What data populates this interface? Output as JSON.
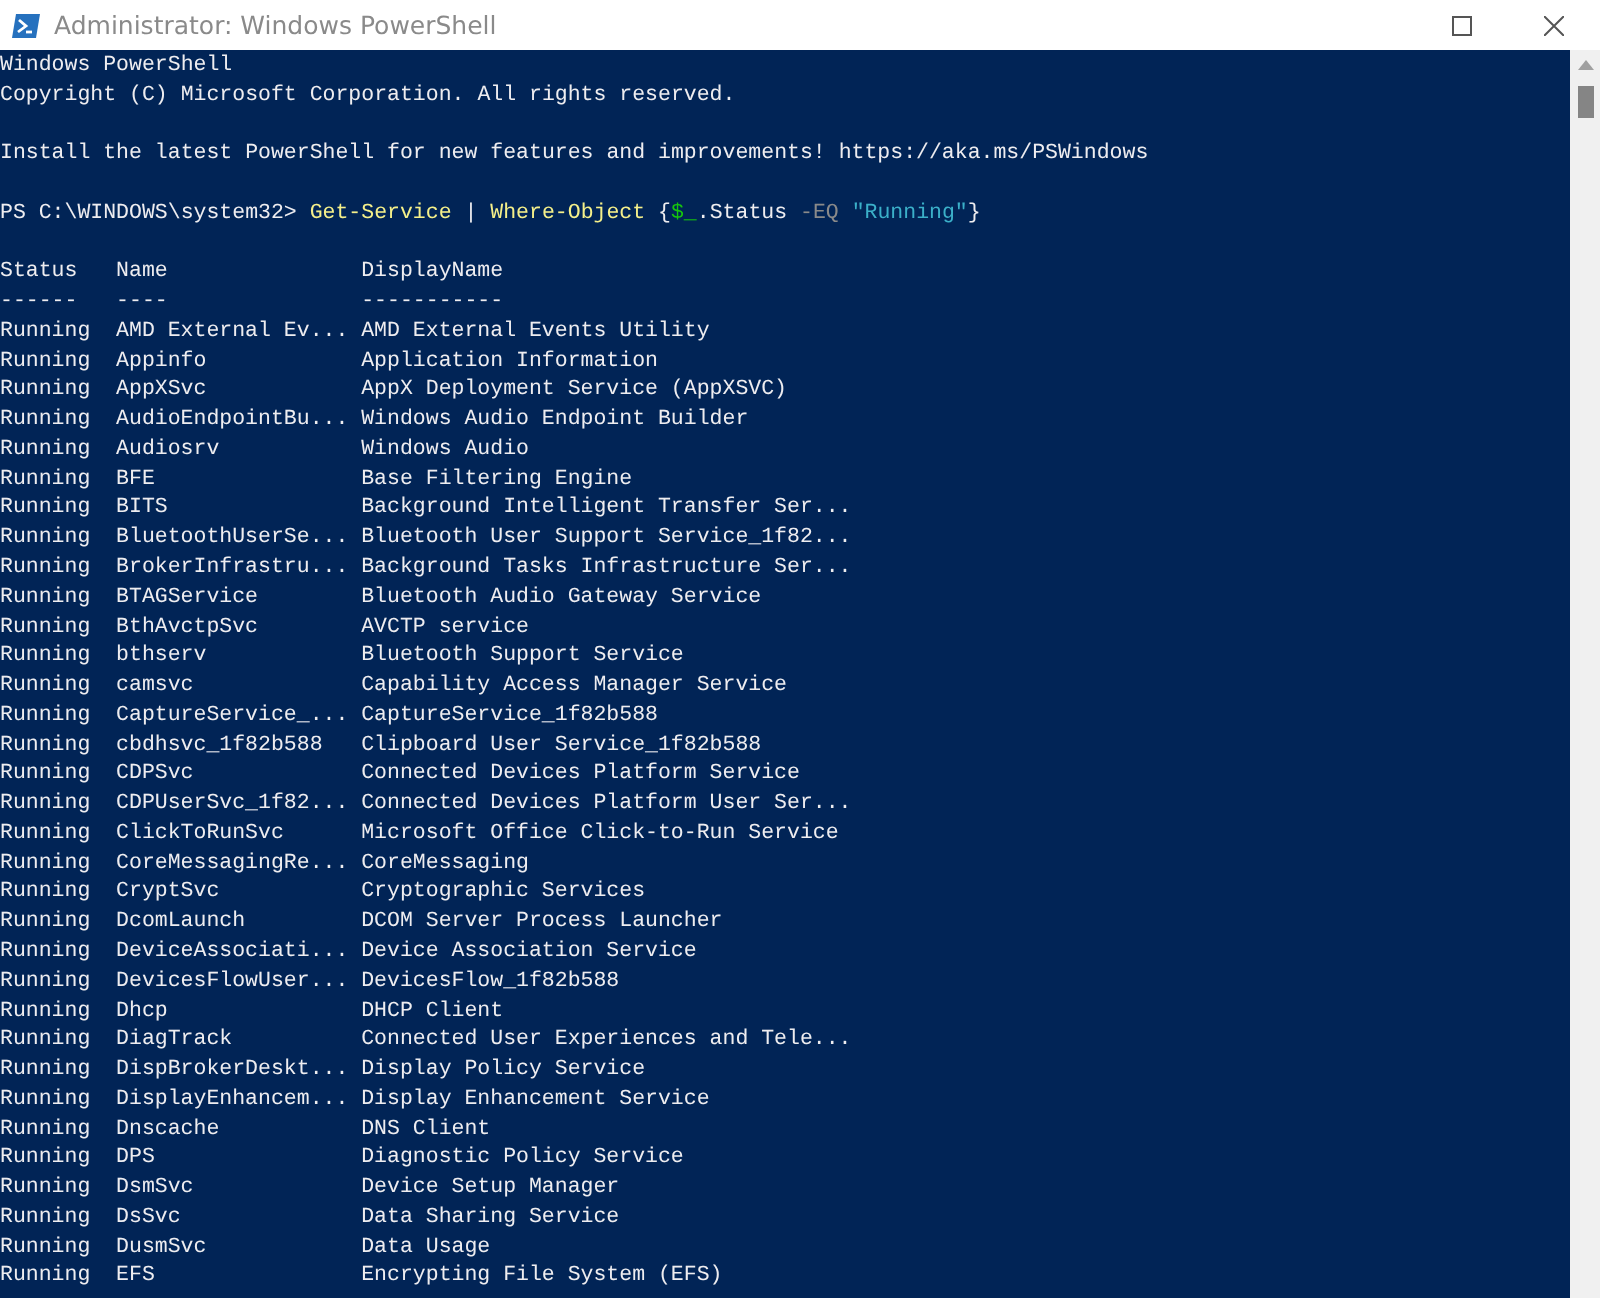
{
  "window": {
    "title": "Administrator: Windows PowerShell"
  },
  "console": {
    "banner": [
      "Windows PowerShell",
      "Copyright (C) Microsoft Corporation. All rights reserved."
    ],
    "notice": "Install the latest PowerShell for new features and improvements! https://aka.ms/PSWindows",
    "command": [
      {
        "kind": "prompt",
        "text": "PS C:\\WINDOWS\\system32> "
      },
      {
        "kind": "cmdlet",
        "text": "Get-Service"
      },
      {
        "kind": "plain",
        "text": " | "
      },
      {
        "kind": "cmdlet",
        "text": "Where-Object"
      },
      {
        "kind": "plain",
        "text": " {"
      },
      {
        "kind": "variable",
        "text": "$_"
      },
      {
        "kind": "plain",
        "text": ".Status "
      },
      {
        "kind": "operator",
        "text": "-EQ "
      },
      {
        "kind": "string",
        "text": "\"Running\""
      },
      {
        "kind": "plain",
        "text": "}"
      }
    ],
    "table": {
      "columns": [
        {
          "heading": "Status",
          "underline": "------"
        },
        {
          "heading": "Name",
          "underline": "----"
        },
        {
          "heading": "DisplayName",
          "underline": "-----------"
        }
      ],
      "rows": [
        [
          "Running",
          "AMD External Ev...",
          "AMD External Events Utility"
        ],
        [
          "Running",
          "Appinfo",
          "Application Information"
        ],
        [
          "Running",
          "AppXSvc",
          "AppX Deployment Service (AppXSVC)"
        ],
        [
          "Running",
          "AudioEndpointBu...",
          "Windows Audio Endpoint Builder"
        ],
        [
          "Running",
          "Audiosrv",
          "Windows Audio"
        ],
        [
          "Running",
          "BFE",
          "Base Filtering Engine"
        ],
        [
          "Running",
          "BITS",
          "Background Intelligent Transfer Ser..."
        ],
        [
          "Running",
          "BluetoothUserSe...",
          "Bluetooth User Support Service_1f82..."
        ],
        [
          "Running",
          "BrokerInfrastru...",
          "Background Tasks Infrastructure Ser..."
        ],
        [
          "Running",
          "BTAGService",
          "Bluetooth Audio Gateway Service"
        ],
        [
          "Running",
          "BthAvctpSvc",
          "AVCTP service"
        ],
        [
          "Running",
          "bthserv",
          "Bluetooth Support Service"
        ],
        [
          "Running",
          "camsvc",
          "Capability Access Manager Service"
        ],
        [
          "Running",
          "CaptureService_...",
          "CaptureService_1f82b588"
        ],
        [
          "Running",
          "cbdhsvc_1f82b588",
          "Clipboard User Service_1f82b588"
        ],
        [
          "Running",
          "CDPSvc",
          "Connected Devices Platform Service"
        ],
        [
          "Running",
          "CDPUserSvc_1f82...",
          "Connected Devices Platform User Ser..."
        ],
        [
          "Running",
          "ClickToRunSvc",
          "Microsoft Office Click-to-Run Service"
        ],
        [
          "Running",
          "CoreMessagingRe...",
          "CoreMessaging"
        ],
        [
          "Running",
          "CryptSvc",
          "Cryptographic Services"
        ],
        [
          "Running",
          "DcomLaunch",
          "DCOM Server Process Launcher"
        ],
        [
          "Running",
          "DeviceAssociati...",
          "Device Association Service"
        ],
        [
          "Running",
          "DevicesFlowUser...",
          "DevicesFlow_1f82b588"
        ],
        [
          "Running",
          "Dhcp",
          "DHCP Client"
        ],
        [
          "Running",
          "DiagTrack",
          "Connected User Experiences and Tele..."
        ],
        [
          "Running",
          "DispBrokerDeskt...",
          "Display Policy Service"
        ],
        [
          "Running",
          "DisplayEnhancem...",
          "Display Enhancement Service"
        ],
        [
          "Running",
          "Dnscache",
          "DNS Client"
        ],
        [
          "Running",
          "DPS",
          "Diagnostic Policy Service"
        ],
        [
          "Running",
          "DsmSvc",
          "Device Setup Manager"
        ],
        [
          "Running",
          "DsSvc",
          "Data Sharing Service"
        ],
        [
          "Running",
          "DusmSvc",
          "Data Usage"
        ],
        [
          "Running",
          "EFS",
          "Encrypting File System (EFS)"
        ]
      ]
    }
  }
}
